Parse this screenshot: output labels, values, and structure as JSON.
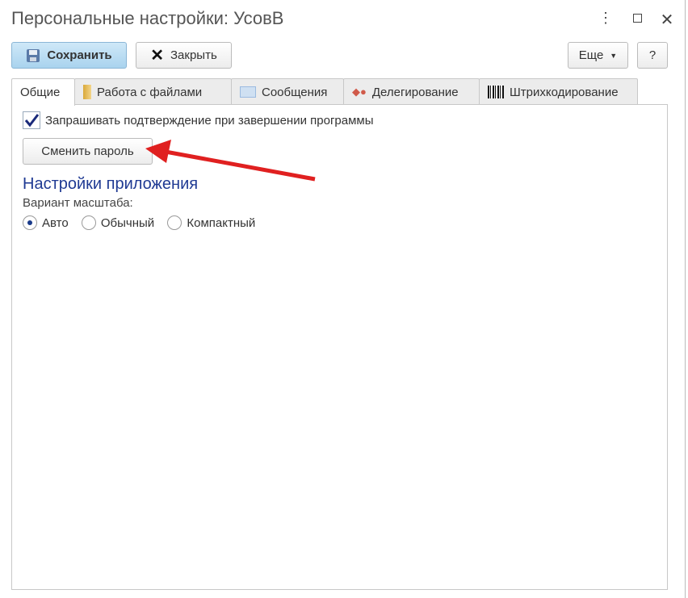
{
  "window": {
    "title": "Персональные настройки: УсовВ"
  },
  "toolbar": {
    "save_label": "Сохранить",
    "close_label": "Закрыть",
    "more_label": "Еще",
    "help_label": "?"
  },
  "tabs": [
    {
      "label": "Общие"
    },
    {
      "label": "Работа с файлами"
    },
    {
      "label": "Сообщения"
    },
    {
      "label": "Делегирование"
    },
    {
      "label": "Штрихкодирование"
    }
  ],
  "general": {
    "confirm_exit_label": "Запрашивать подтверждение при завершении программы",
    "confirm_exit_checked": true,
    "change_password_label": "Сменить пароль",
    "app_settings_heading": "Настройки приложения",
    "scale_label": "Вариант масштаба:",
    "scale_options": [
      {
        "label": "Авто",
        "selected": true
      },
      {
        "label": "Обычный",
        "selected": false
      },
      {
        "label": "Компактный",
        "selected": false
      }
    ]
  },
  "colors": {
    "heading": "#1f3a93",
    "arrow": "#e02020",
    "accent": "#a9d3ee"
  }
}
